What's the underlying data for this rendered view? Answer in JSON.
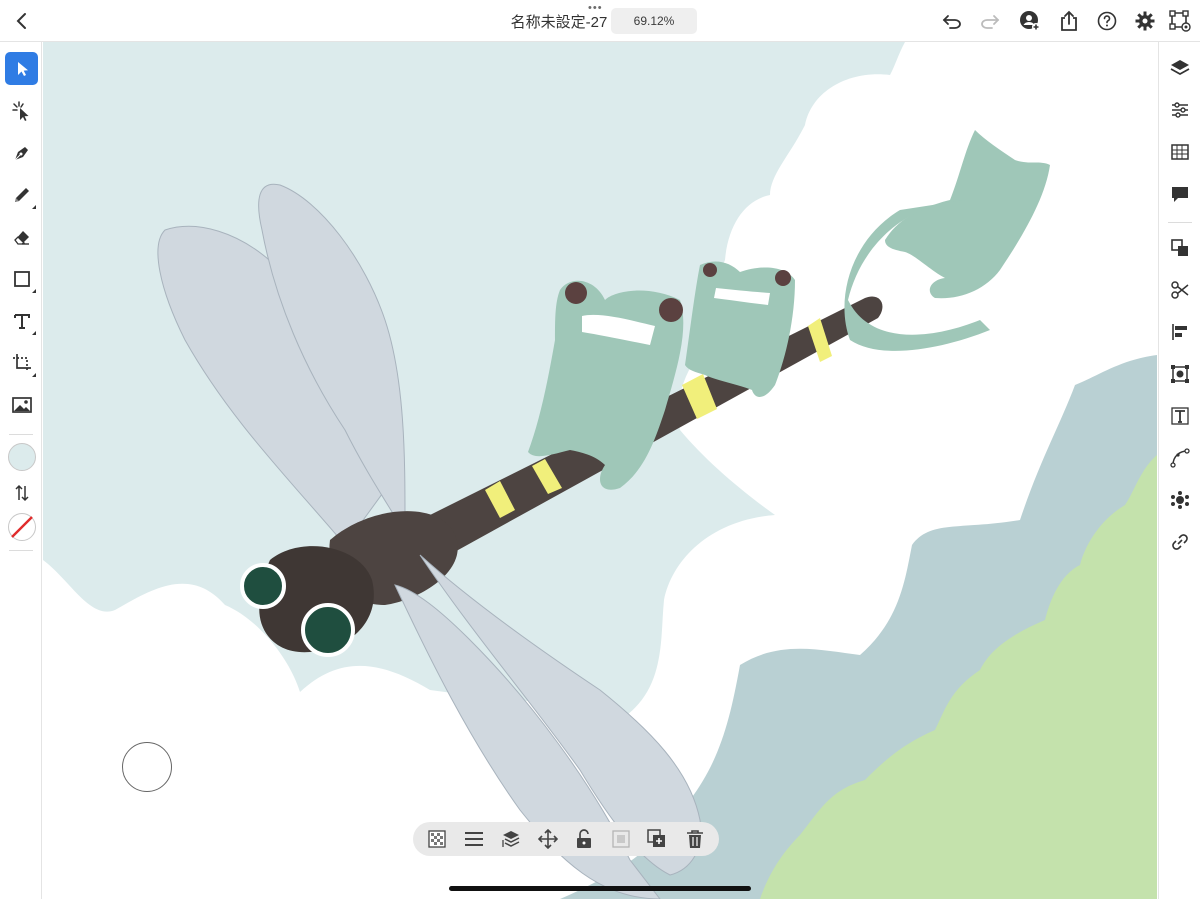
{
  "header": {
    "title": "名称未設定-27",
    "zoom": "69.12%",
    "more_dots": "•••"
  },
  "icons": {
    "back": "chevron-left-icon",
    "undo": "undo-icon",
    "redo": "redo-icon",
    "invite": "invite-user-icon",
    "share": "share-icon",
    "help": "help-icon",
    "settings": "gear-icon",
    "touch_shortcut": "touch-shortcut-icon"
  },
  "left_tools": [
    {
      "id": "selection",
      "icon": "selection-arrow-icon",
      "active": true
    },
    {
      "id": "direct-selection",
      "icon": "direct-selection-icon"
    },
    {
      "id": "pen",
      "icon": "pen-icon"
    },
    {
      "id": "pencil",
      "icon": "pencil-icon"
    },
    {
      "id": "eraser",
      "icon": "eraser-icon"
    },
    {
      "id": "rectangle",
      "icon": "rectangle-icon"
    },
    {
      "id": "type",
      "icon": "type-icon"
    },
    {
      "id": "crop",
      "icon": "crop-icon"
    },
    {
      "id": "place-image",
      "icon": "image-icon"
    }
  ],
  "colors": {
    "fill": "#dcebec",
    "stroke": "none",
    "accent": "#2f7ce4"
  },
  "right_panel": [
    "layers-icon",
    "properties-icon",
    "swatches-icon",
    "comments-icon",
    "arrange-icon",
    "scissors-icon",
    "align-icon",
    "transform-icon",
    "text-properties-icon",
    "path-icon",
    "symbol-icon",
    "link-icon"
  ],
  "quick_actions": [
    "checkerboard-icon",
    "menu-lines-icon",
    "layer-order-icon",
    "move-icon",
    "unlock-icon",
    "image-placeholder-icon",
    "duplicate-icon",
    "trash-icon"
  ]
}
